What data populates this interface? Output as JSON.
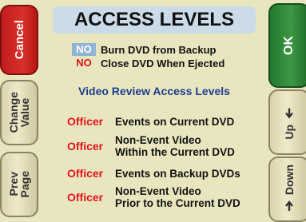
{
  "title": "ACCESS LEVELS",
  "toggles": [
    {
      "value": "NO",
      "label": "Burn DVD from Backup",
      "style": "highlighted"
    },
    {
      "value": "NO",
      "label": "Close DVD When Ejected",
      "style": "plain"
    }
  ],
  "section_heading": "Video Review Access Levels",
  "access_items": [
    {
      "role": "Officer",
      "line1": "Events on Current DVD",
      "line2": ""
    },
    {
      "role": "Officer",
      "line1": "Non-Event Video",
      "line2": "Within the Current DVD"
    },
    {
      "role": "Officer",
      "line1": "Events on Backup DVDs",
      "line2": ""
    },
    {
      "role": "Officer",
      "line1": "Non-Event Video",
      "line2": "Prior to the Current DVD"
    }
  ],
  "left_buttons": {
    "cancel": "Cancel",
    "change_value_1": "Change",
    "change_value_2": "Value",
    "prev_page_1": "Prev",
    "prev_page_2": "Page"
  },
  "right_buttons": {
    "ok": "OK",
    "up": "Up",
    "down": "Down"
  },
  "colors": {
    "background": "#e9e6bf",
    "title_bar": "#cbdbe8",
    "cancel": "#c21d1d",
    "ok": "#237a2e",
    "role_text": "#e0141a",
    "section_heading": "#1c3d8f"
  },
  "icons": {
    "up": "up-arrow-icon",
    "down": "down-arrow-icon"
  }
}
